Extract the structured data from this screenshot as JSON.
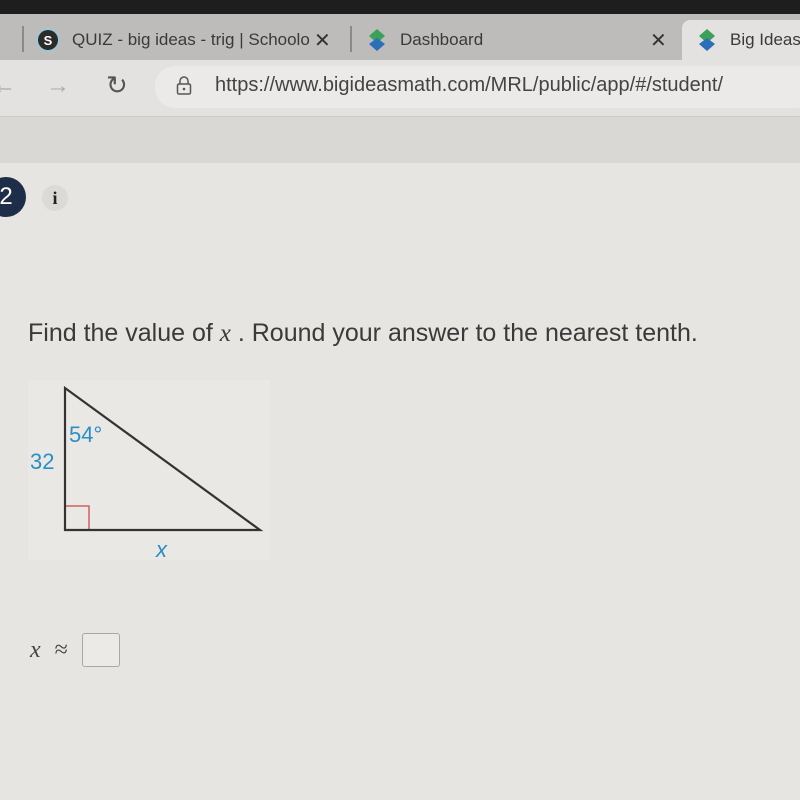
{
  "browser": {
    "tabs": [
      {
        "title": "QUIZ - big ideas - trig | Schoolog",
        "icon": "schoology-icon",
        "icon_glyph": "S",
        "close": "✕"
      },
      {
        "title": "Dashboard",
        "icon": "big-ideas-icon",
        "close": "✕"
      },
      {
        "title": "Big Ideas",
        "icon": "big-ideas-icon",
        "active": true
      }
    ],
    "url": "https://www.bigideasmath.com/MRL/public/app/#/student/",
    "back_glyph": "←",
    "forward_glyph": "→",
    "reload_glyph": "↻"
  },
  "question": {
    "number": "2",
    "info_glyph": "i",
    "prompt_before": "Find the value of ",
    "variable": "x",
    "prompt_after": " . Round your answer to the nearest tenth."
  },
  "figure": {
    "side_label": "32",
    "angle_label": "54°",
    "unknown_label": "x",
    "colors": {
      "label": "#2a8fc4",
      "right_angle": "#d0605e",
      "lines": "#333333"
    }
  },
  "answer": {
    "variable": "x",
    "symbol": "≈",
    "value": ""
  }
}
